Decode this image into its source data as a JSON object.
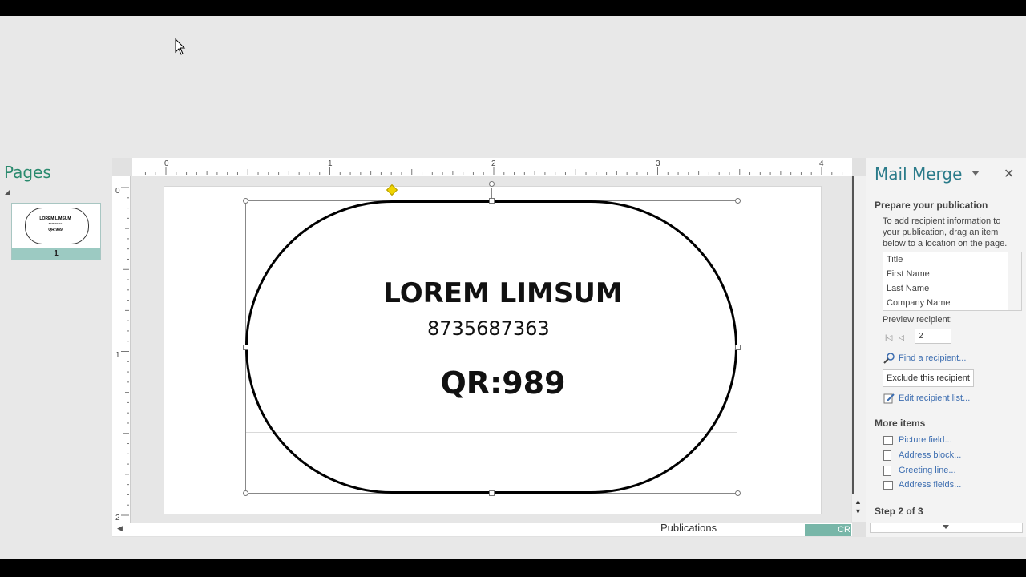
{
  "pages_pane": {
    "title": "Pages",
    "thumbnail": {
      "page_number": "1",
      "line1": "LOREM LIMSUM",
      "line2": "8735687363",
      "line3": "QR:989"
    }
  },
  "rulers": {
    "horizontal": [
      "0",
      "1",
      "2",
      "3",
      "4"
    ],
    "vertical": [
      "0",
      "1",
      "2"
    ]
  },
  "document": {
    "name": "LOREM LIMSUM",
    "phone": "8735687363",
    "qr": "QR:989",
    "colors": {
      "adjust_handle": "#f0d400",
      "shape_border": "#000000"
    }
  },
  "status": {
    "tab_label": "Publications",
    "tab_cr": "CR"
  },
  "mail_merge": {
    "title": "Mail Merge",
    "close_glyph": "✕",
    "prepare_heading": "Prepare your publication",
    "description": "To add recipient information to your publication, drag an item below to a location on the page.",
    "fields": [
      "Title",
      "First Name",
      "Last Name",
      "Company Name"
    ],
    "preview_label": "Preview recipient:",
    "recipient_value": "2",
    "find_recipient": "Find a recipient...",
    "exclude_button": "Exclude this recipient",
    "edit_list": "Edit recipient list...",
    "more_items_heading": "More items",
    "more_items": [
      "Picture field...",
      "Address block...",
      "Greeting line...",
      "Address fields..."
    ],
    "step": "Step 2 of 3",
    "link_color": "#3c6db0",
    "title_color": "#2a7b8a"
  }
}
